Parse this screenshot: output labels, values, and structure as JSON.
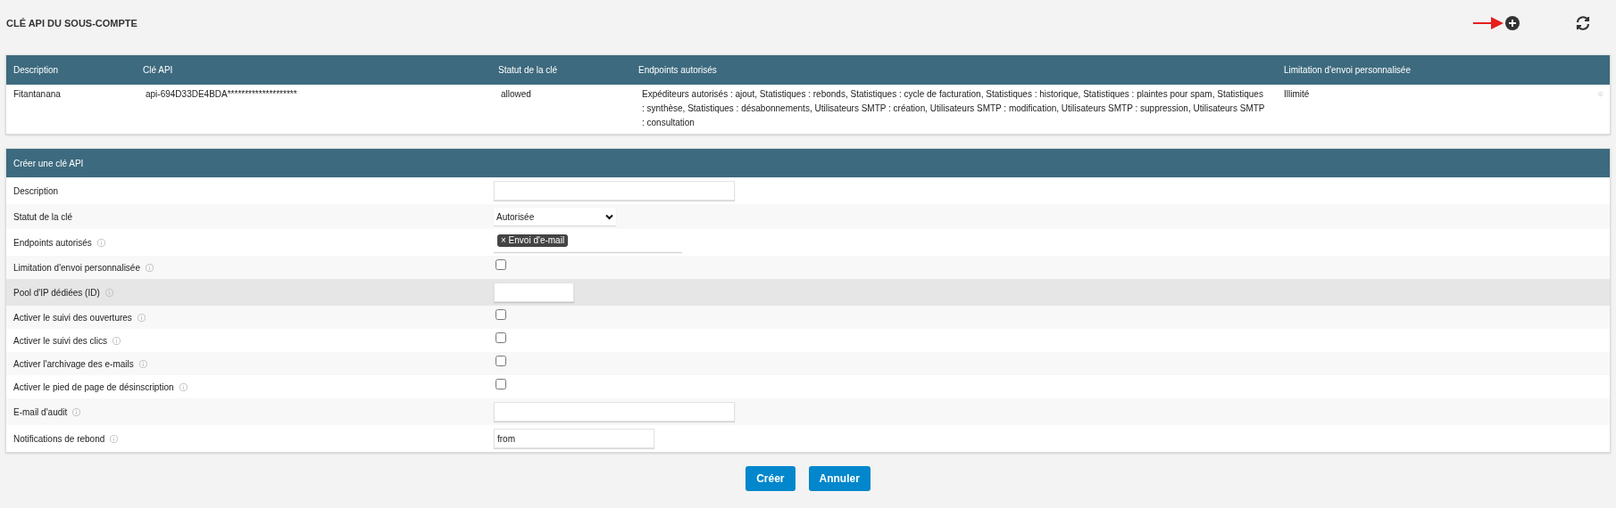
{
  "page_title": "CLÉ API DU SOUS-COMPTE",
  "keys_table": {
    "columns": [
      "Description",
      "Clé API",
      "Statut de la clé",
      "Endpoints autorisés",
      "Limitation d'envoi personnalisée"
    ],
    "rows": [
      {
        "cells": [
          "Fitantanana",
          "api-694D33DE4BDA********************",
          "allowed",
          "Expéditeurs autorisés : ajout, Statistiques : rebonds, Statistiques : cycle de facturation, Statistiques : historique, Statistiques : plaintes pour spam, Statistiques : synthèse, Statistiques : désabonnements, Utilisateurs SMTP : création, Utilisateurs SMTP : modification, Utilisateurs SMTP : suppression, Utilisateurs SMTP : consultation",
          "Illimité"
        ]
      }
    ]
  },
  "create_form": {
    "title": "Créer une clé API",
    "fields": [
      {
        "kind": "text",
        "label": "Description",
        "info": false,
        "highlighted": false
      },
      {
        "kind": "select",
        "label": "Statut de la clé",
        "info": false,
        "highlighted": false,
        "value": "Autorisée"
      },
      {
        "kind": "tags",
        "label": "Endpoints autorisés",
        "info": true,
        "highlighted": false,
        "tags": [
          {
            "remove": "×",
            "label": "Envoi d'e-mail"
          }
        ]
      },
      {
        "kind": "checkbox",
        "label": "Limitation d'envoi personnalisée",
        "info": true,
        "highlighted": false,
        "checked": false
      },
      {
        "kind": "text",
        "label": "Pool d'IP dédiées (ID)",
        "info": true,
        "highlighted": true
      },
      {
        "kind": "checkbox",
        "label": "Activer le suivi des ouvertures",
        "info": true,
        "highlighted": false,
        "checked": false
      },
      {
        "kind": "checkbox",
        "label": "Activer le suivi des clics",
        "info": true,
        "highlighted": false,
        "checked": false
      },
      {
        "kind": "checkbox",
        "label": "Activer l'archivage des e-mails",
        "info": true,
        "highlighted": false,
        "checked": false
      },
      {
        "kind": "checkbox",
        "label": "Activer le pied de page de désinscription",
        "info": true,
        "highlighted": false,
        "checked": false
      },
      {
        "kind": "text",
        "label": "E-mail d'audit",
        "info": true,
        "highlighted": false
      },
      {
        "kind": "text",
        "label": "Notifications de rebond",
        "info": true,
        "highlighted": false,
        "value": "from"
      }
    ]
  },
  "buttons": [
    "Créer",
    "Annuler"
  ]
}
